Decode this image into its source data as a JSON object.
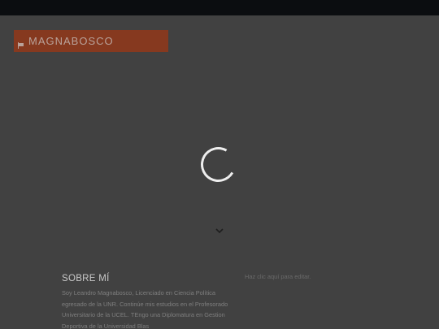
{
  "site": {
    "brand": "MAGNABOSCO",
    "brand_icon": "flag-icon",
    "accent": "#86391f",
    "topbar_color": "#0b0d10",
    "background": "#414141"
  },
  "hero": {
    "loading_icon": "spinner-icon",
    "scroll_icon": "chevron-down-icon"
  },
  "about": {
    "title": "SOBRE MÍ",
    "body": "Soy Leandro Magnabosco, Licenciado en Ciencia Política egresado de la UNR. Continúe mis estudios en el Profesorado Universitario de la UCEL. TEngo una Diplomatura en Gestion Deportiva de la Universidad Blas"
  },
  "search": {
    "hint": "Haz clic aquí para editar."
  }
}
